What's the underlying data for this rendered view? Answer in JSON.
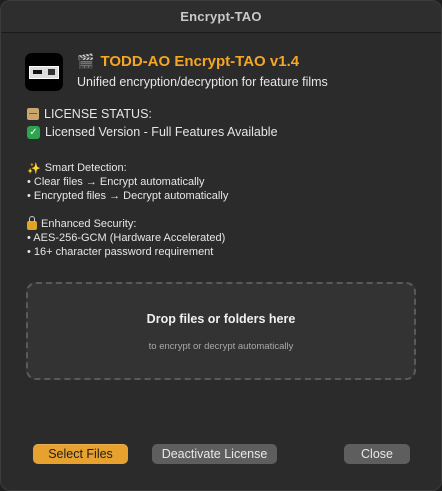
{
  "window": {
    "title": "Encrypt-TAO"
  },
  "header": {
    "logo_icon": "film-strip-logo",
    "title_icon": "clapper-board-icon",
    "title": "TODD-AO Encrypt-TAO v1.4",
    "subtitle": "Unified encryption/decryption for feature films"
  },
  "license": {
    "heading_icon": "scroll-icon",
    "heading": "LICENSE STATUS:",
    "status_icon": "check-mark-icon",
    "status": "Licensed Version - Full Features Available"
  },
  "smart_detection": {
    "icon": "sparkles-icon",
    "heading": "Smart Detection:",
    "items": [
      "• Clear files → Encrypt automatically",
      "• Encrypted files → Decrypt automatically"
    ]
  },
  "security": {
    "icon": "lock-icon",
    "heading": "Enhanced Security:",
    "items": [
      "• AES-256-GCM (Hardware Accelerated)",
      "• 16+ character password requirement"
    ]
  },
  "dropzone": {
    "title": "Drop files or folders here",
    "subtitle": "to encrypt or decrypt automatically"
  },
  "buttons": {
    "select": "Select Files",
    "deactivate": "Deactivate License",
    "close": "Close"
  },
  "colors": {
    "accent": "#f5a623",
    "button_primary": "#e6a12e",
    "button_secondary": "#5e5e5e",
    "background": "#2b2b2b"
  }
}
